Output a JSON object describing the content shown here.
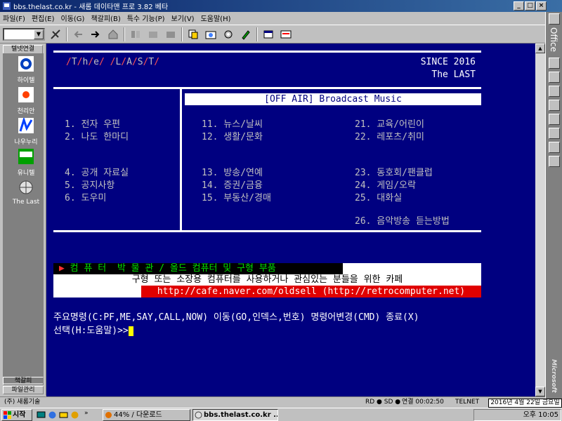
{
  "window": {
    "title": "bbs.thelast.co.kr - 새롬 데이타맨 프로 3.82 베타",
    "min_label": "_",
    "max_label": "□",
    "close_label": "×"
  },
  "menu": [
    "파일(F)",
    "편집(E)",
    "이동(G)",
    "책갈피(B)",
    "특수 기능(P)",
    "보기(V)",
    "도움말(H)"
  ],
  "left_panel": {
    "header": "텔넷연결",
    "items": [
      "하이텔",
      "천리안",
      "나우누리",
      "유니텔",
      "The Last"
    ],
    "bottom1": "책갈피",
    "bottom2": "파일관리"
  },
  "terminal": {
    "logo_chars": [
      "T",
      "h",
      "e",
      "L",
      "A",
      "S",
      "T"
    ],
    "since": "SINCE 2016",
    "the_last": "The LAST",
    "offair": "[OFF AIR] Broadcast Music",
    "col1": [
      "1. 전자 우편",
      "2. 나도 한마디",
      "4. 공개 자료실",
      "5. 공지사항",
      "6. 도우미"
    ],
    "col2": [
      "11. 뉴스/날씨",
      "12. 생활/문화",
      "13. 방송/연예",
      "14. 증권/금융",
      "15. 부동산/경매"
    ],
    "col3": [
      "21. 교육/어린이",
      "22. 레포츠/취미",
      "23. 동호회/팬클럽",
      "24. 게임/오락",
      "25. 대화실",
      "26. 음악방송 듣는방법"
    ],
    "banner_arrow": "▶",
    "banner_title": "컴 퓨 터  박 물 관 / 올드 컴퓨터 및 구형 부품",
    "banner_sub": "구형 또는 소장용 컴퓨터를 사용하거나 관심있는 분들을 위한 카페",
    "banner_url": "http://cafe.naver.com/oldsell (http://retrocomputer.net)",
    "cmd_line1": "주요명령(C:PF,ME,SAY,CALL,NOW) 이동(GO,인덱스,번호) 명령어변경(CMD) 종료(X)",
    "cmd_line2": "선택(H:도움말)>>"
  },
  "office_bar": {
    "label": "Office",
    "brand": "Microsoft"
  },
  "status": {
    "left": "(주) 새롬기술",
    "rd": "RD ● SD ●",
    "conn": "연결 00:02:50",
    "proto": "TELNET",
    "date": "2016년 4월 22일 금요일"
  },
  "taskbar": {
    "start": "시작",
    "task1": "44% / 다운로드",
    "task2": "bbs.thelast.co.kr ...",
    "clock": "오후 10:05"
  }
}
